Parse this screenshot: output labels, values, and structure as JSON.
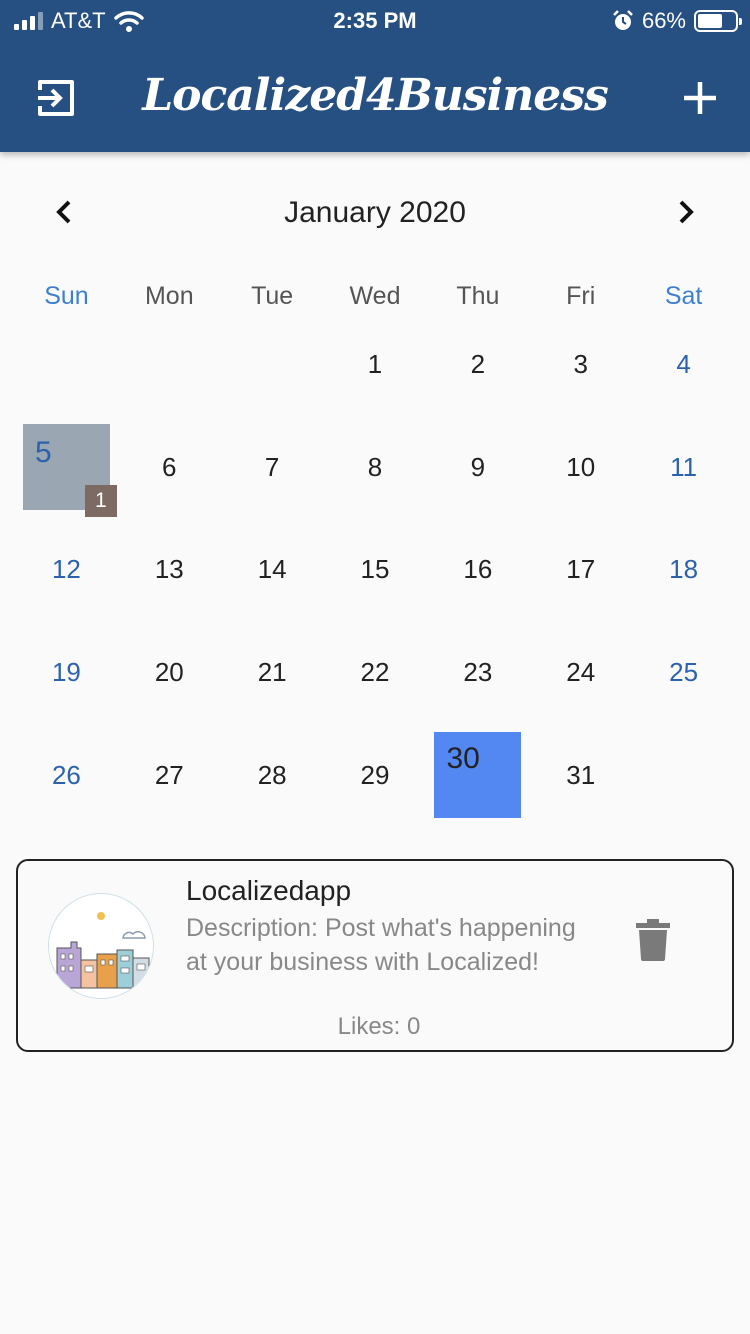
{
  "status_bar": {
    "carrier": "AT&T",
    "time": "2:35 PM",
    "battery": "66%",
    "battery_level": 0.66
  },
  "navbar": {
    "title": "Localized4Business",
    "exit_icon": "exit-icon",
    "add_icon": "plus-icon"
  },
  "calendar": {
    "month_title": "January 2020",
    "weekdays": [
      "Sun",
      "Mon",
      "Tue",
      "Wed",
      "Thu",
      "Fri",
      "Sat"
    ],
    "leading_blanks": 3,
    "days": [
      "1",
      "2",
      "3",
      "4",
      "5",
      "6",
      "7",
      "8",
      "9",
      "10",
      "11",
      "12",
      "13",
      "14",
      "15",
      "16",
      "17",
      "18",
      "19",
      "20",
      "21",
      "22",
      "23",
      "24",
      "25",
      "26",
      "27",
      "28",
      "29",
      "30",
      "31"
    ],
    "marked_day": "5",
    "marked_day_badge": "1",
    "today": "30"
  },
  "post": {
    "title": "Localizedapp",
    "description": "Description: Post what's happening at your business with Localized!",
    "likes": "Likes: 0"
  },
  "colors": {
    "header": "#264f82",
    "weekend_text": "#2c62ad",
    "marked_day_bg": "#9aa6b1",
    "today_bg": "#5388f3",
    "badge_bg": "#7d6b63"
  }
}
